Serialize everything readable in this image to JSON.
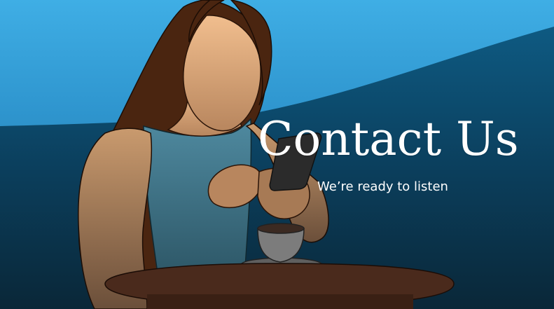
{
  "hero": {
    "title": "Contact Us",
    "subtitle": "We’re ready to listen",
    "illustration_icon": "woman-with-phone-and-coffee-illustration"
  },
  "colors": {
    "sky_top": "#3aa8e1",
    "sky_mid": "#1d7fb4",
    "deep_bottom": "#0a2a3d",
    "wave": "#0d4d73",
    "hair": "#4a2510",
    "skin": "#e8b88a",
    "top": "#4b8399",
    "table": "#4a2a1c",
    "cup": "#8a8a8a",
    "text": "#ffffff"
  }
}
